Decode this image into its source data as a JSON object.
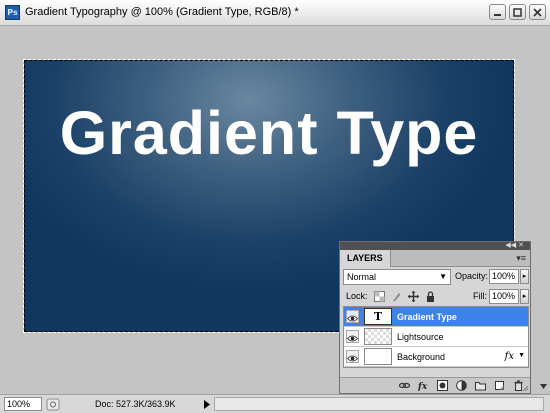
{
  "window": {
    "title": "Gradient Typography @ 100% (Gradient Type, RGB/8) *",
    "app_icon": "Ps"
  },
  "document": {
    "text": "Gradient Type",
    "colors": {
      "center": "#6a87a0",
      "edge": "#0f3760"
    }
  },
  "statusbar": {
    "zoom": "100%",
    "doc_size": "Doc: 527.3K/363.9K"
  },
  "layers_panel": {
    "tab_label": "LAYERS",
    "blend_mode": "Normal",
    "opacity_label": "Opacity:",
    "opacity_value": "100%",
    "lock_label": "Lock:",
    "fill_label": "Fill:",
    "fill_value": "100%",
    "layers": [
      {
        "name": "Gradient Type",
        "thumb": "T",
        "selected": true,
        "kind": "type"
      },
      {
        "name": "Lightsource",
        "selected": false,
        "kind": "transparent"
      },
      {
        "name": "Background",
        "selected": false,
        "kind": "solid",
        "fx": "fx"
      }
    ]
  },
  "accent_color": "#3d82e8"
}
